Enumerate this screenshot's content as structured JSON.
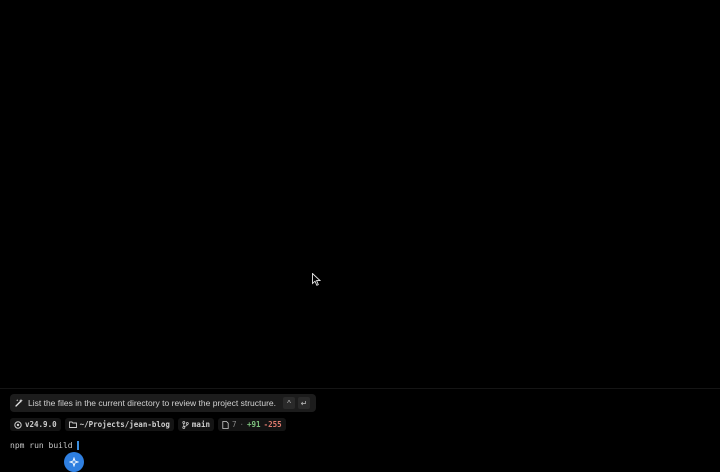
{
  "suggestion": {
    "text": "List the files in the current directory to review the project structure.",
    "expand_key": "^",
    "enter_key": "↵"
  },
  "status": {
    "node_version": "v24.9.0",
    "path": "~/Projects/jean-blog",
    "branch": "main",
    "files_changed": "7",
    "additions": "+91",
    "deletions": "-255"
  },
  "terminal": {
    "input": "npm run build"
  },
  "icons": {
    "suggestion": "sparkle-icon",
    "node": "node-icon",
    "folder": "folder-icon",
    "branch": "git-branch-icon",
    "file": "file-icon",
    "fab": "sparkle-icon",
    "pointer": "mouse-pointer-icon"
  },
  "colors": {
    "background": "#000000",
    "accent": "#2f7fe0",
    "additions": "#7ec27e",
    "deletions": "#e07a6e"
  }
}
